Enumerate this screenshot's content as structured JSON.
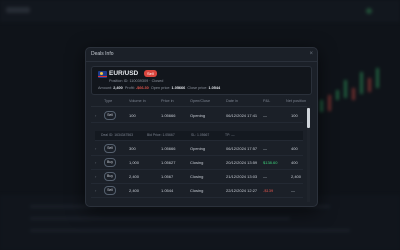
{
  "modal": {
    "title": "Deals Info",
    "close_icon": "×"
  },
  "summary": {
    "pair": "EUR/USD",
    "side": "Sell",
    "position_line": "Position ID: 110039309 · Closed",
    "amount_label": "Amount:",
    "amount": "2,400",
    "profit_label": "Profit:",
    "profit": "-$66.30",
    "open_label": "Open price:",
    "open_price": "1.05666",
    "close_label": "Close price:",
    "close_price": "1.0544"
  },
  "table": {
    "headers": [
      "Type",
      "Volume in",
      "Price in",
      "Open/Close",
      "Date in",
      "P&L",
      "Net position"
    ],
    "subrow": {
      "deal": "Deal ID: 1634347563",
      "bid": "Bid Price: 1.05667",
      "sl": "SL: 1.05667",
      "tp": "TP: —"
    },
    "rows": [
      {
        "type": "Sell",
        "volume": "100",
        "price": "1.05666",
        "action": "Opening",
        "date": "06/12/2024 17:41",
        "pnl": "—",
        "net": "100",
        "pnl_class": ""
      },
      {
        "type": "Sell",
        "volume": "300",
        "price": "1.05666",
        "action": "Opening",
        "date": "06/12/2024 17:57",
        "pnl": "—",
        "net": "400",
        "pnl_class": ""
      },
      {
        "type": "Buy",
        "volume": "1,000",
        "price": "1.05627",
        "action": "Closing",
        "date": "20/12/2024 13:59",
        "pnl": "$138.60",
        "net": "400",
        "pnl_class": "pos"
      },
      {
        "type": "Buy",
        "volume": "2,400",
        "price": "1.0567",
        "action": "Closing",
        "date": "21/12/2024 13:03",
        "pnl": "—",
        "net": "2,400",
        "pnl_class": ""
      },
      {
        "type": "Sell",
        "volume": "2,400",
        "price": "1.0544",
        "action": "Closing",
        "date": "22/12/2024 12:27",
        "pnl": "-$139",
        "net": "—",
        "pnl_class": "neg"
      }
    ]
  }
}
